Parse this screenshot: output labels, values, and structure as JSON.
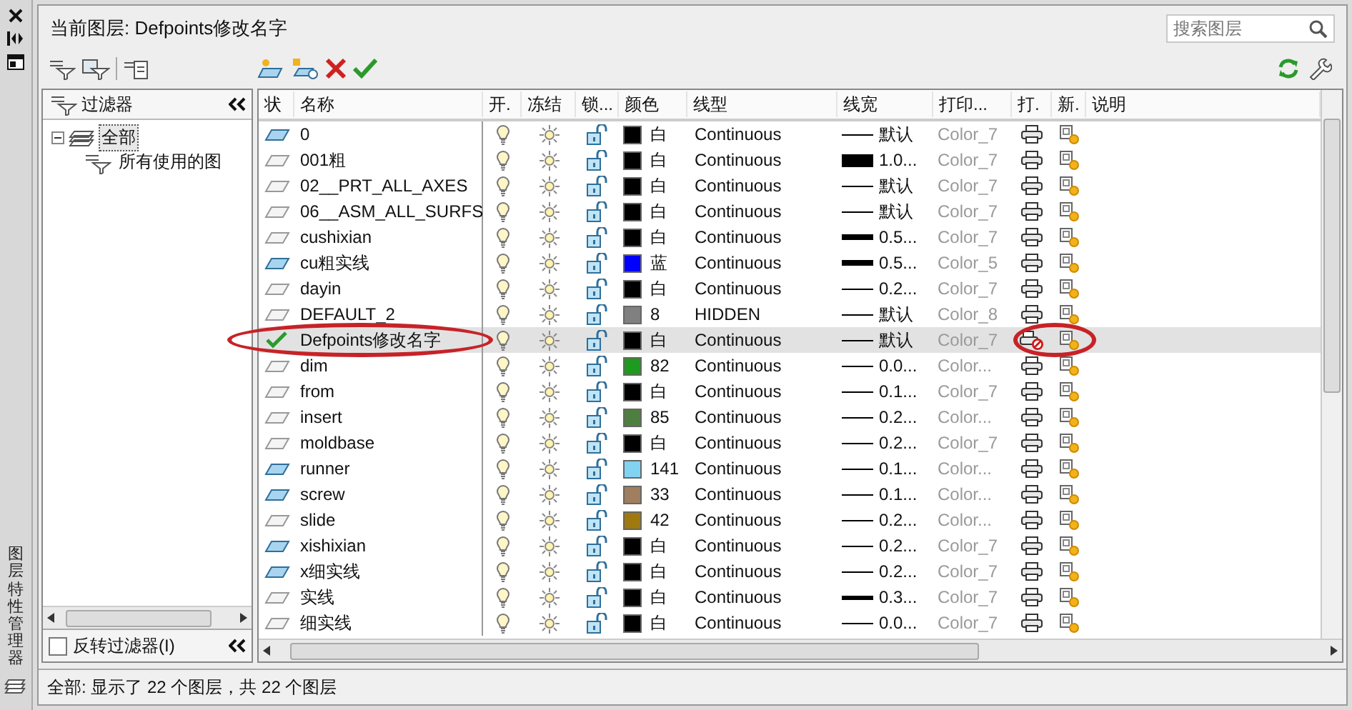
{
  "palette_title": "图层特性管理器",
  "current_layer": {
    "label": "当前图层:",
    "value": "Defpoints修改名字"
  },
  "search": {
    "placeholder": "搜索图层"
  },
  "filter_panel": {
    "title": "过滤器",
    "tree": [
      {
        "label": "全部",
        "expanded": true,
        "selected": true,
        "children": [
          {
            "label": "所有使用的图",
            "selected": false
          }
        ]
      }
    ],
    "invert_filter": {
      "label": "反转过滤器(I)",
      "checked": false
    }
  },
  "table": {
    "columns": [
      "状",
      "名称",
      "开.",
      "冻结",
      "锁...",
      "颜色",
      "线型",
      "线宽",
      "打印...",
      "打.",
      "新.",
      "说明"
    ],
    "rows": [
      {
        "current": false,
        "in_use": true,
        "name": "0",
        "color": "#000000",
        "color_name": "白",
        "linetype": "Continuous",
        "kind": "thin",
        "lineweight": "默认",
        "plot_style": "Color_7",
        "plot": true,
        "selected": false
      },
      {
        "current": false,
        "in_use": false,
        "name": "001粗",
        "color": "#000000",
        "color_name": "白",
        "linetype": "Continuous",
        "kind": "heavy",
        "lineweight": "1.0...",
        "plot_style": "Color_7",
        "plot": true,
        "selected": false
      },
      {
        "current": false,
        "in_use": false,
        "name": "02__PRT_ALL_AXES",
        "color": "#000000",
        "color_name": "白",
        "linetype": "Continuous",
        "kind": "thin",
        "lineweight": "默认",
        "plot_style": "Color_7",
        "plot": true,
        "selected": false
      },
      {
        "current": false,
        "in_use": false,
        "name": "06__ASM_ALL_SURFS",
        "color": "#000000",
        "color_name": "白",
        "linetype": "Continuous",
        "kind": "thin",
        "lineweight": "默认",
        "plot_style": "Color_7",
        "plot": true,
        "selected": false
      },
      {
        "current": false,
        "in_use": false,
        "name": "cushixian",
        "color": "#000000",
        "color_name": "白",
        "linetype": "Continuous",
        "kind": "medium",
        "lineweight": "0.5...",
        "plot_style": "Color_7",
        "plot": true,
        "selected": false
      },
      {
        "current": false,
        "in_use": true,
        "name": "cu粗实线",
        "color": "#0000ff",
        "color_name": "蓝",
        "linetype": "Continuous",
        "kind": "medium",
        "lineweight": "0.5...",
        "plot_style": "Color_5",
        "plot": true,
        "selected": false
      },
      {
        "current": false,
        "in_use": false,
        "name": "dayin",
        "color": "#000000",
        "color_name": "白",
        "linetype": "Continuous",
        "kind": "thin",
        "lineweight": "0.2...",
        "plot_style": "Color_7",
        "plot": true,
        "selected": false
      },
      {
        "current": false,
        "in_use": false,
        "name": "DEFAULT_2",
        "color": "#808080",
        "color_name": "8",
        "linetype": "HIDDEN",
        "kind": "thin",
        "lineweight": "默认",
        "plot_style": "Color_8",
        "plot": true,
        "selected": false
      },
      {
        "current": true,
        "name": "Defpoints修改名字",
        "color": "#000000",
        "color_name": "白",
        "linetype": "Continuous",
        "kind": "thin",
        "lineweight": "默认",
        "plot_style": "Color_7",
        "plot": false,
        "selected": true,
        "name_circled": true,
        "plot_circled": true
      },
      {
        "current": false,
        "in_use": false,
        "name": "dim",
        "color": "#1e9a1e",
        "color_name": "82",
        "linetype": "Continuous",
        "kind": "thin",
        "lineweight": "0.0...",
        "plot_style": "Color...",
        "plot": true,
        "selected": false
      },
      {
        "current": false,
        "in_use": false,
        "name": "from",
        "color": "#000000",
        "color_name": "白",
        "linetype": "Continuous",
        "kind": "thin",
        "lineweight": "0.1...",
        "plot_style": "Color_7",
        "plot": true,
        "selected": false
      },
      {
        "current": false,
        "in_use": false,
        "name": "insert",
        "color": "#4f7f3f",
        "color_name": "85",
        "linetype": "Continuous",
        "kind": "thin",
        "lineweight": "0.2...",
        "plot_style": "Color...",
        "plot": true,
        "selected": false
      },
      {
        "current": false,
        "in_use": false,
        "name": "moldbase",
        "color": "#000000",
        "color_name": "白",
        "linetype": "Continuous",
        "kind": "thin",
        "lineweight": "0.2...",
        "plot_style": "Color_7",
        "plot": true,
        "selected": false
      },
      {
        "current": false,
        "in_use": true,
        "name": "runner",
        "color": "#80d4f2",
        "color_name": "141",
        "linetype": "Continuous",
        "kind": "thin",
        "lineweight": "0.1...",
        "plot_style": "Color...",
        "plot": true,
        "selected": false
      },
      {
        "current": false,
        "in_use": true,
        "name": "screw",
        "color": "#a07e60",
        "color_name": "33",
        "linetype": "Continuous",
        "kind": "thin",
        "lineweight": "0.1...",
        "plot_style": "Color...",
        "plot": true,
        "selected": false
      },
      {
        "current": false,
        "in_use": false,
        "name": "slide",
        "color": "#a07810",
        "color_name": "42",
        "linetype": "Continuous",
        "kind": "thin",
        "lineweight": "0.2...",
        "plot_style": "Color...",
        "plot": true,
        "selected": false
      },
      {
        "current": false,
        "in_use": true,
        "name": "xishixian",
        "color": "#000000",
        "color_name": "白",
        "linetype": "Continuous",
        "kind": "thin",
        "lineweight": "0.2...",
        "plot_style": "Color_7",
        "plot": true,
        "selected": false
      },
      {
        "current": false,
        "in_use": true,
        "name": "x细实线",
        "color": "#000000",
        "color_name": "白",
        "linetype": "Continuous",
        "kind": "thin",
        "lineweight": "0.2...",
        "plot_style": "Color_7",
        "plot": true,
        "selected": false
      },
      {
        "current": false,
        "in_use": false,
        "name": "实线",
        "color": "#000000",
        "color_name": "白",
        "linetype": "Continuous",
        "kind": "thick",
        "lineweight": "0.3...",
        "plot_style": "Color_7",
        "plot": true,
        "selected": false
      },
      {
        "current": false,
        "in_use": false,
        "name": "细实线",
        "color": "#000000",
        "color_name": "白",
        "linetype": "Continuous",
        "kind": "thin",
        "lineweight": "0.0...",
        "plot_style": "Color_7",
        "plot": true,
        "selected": false
      }
    ]
  },
  "status_bar": "全部: 显示了 22 个图层，共 22 个图层"
}
